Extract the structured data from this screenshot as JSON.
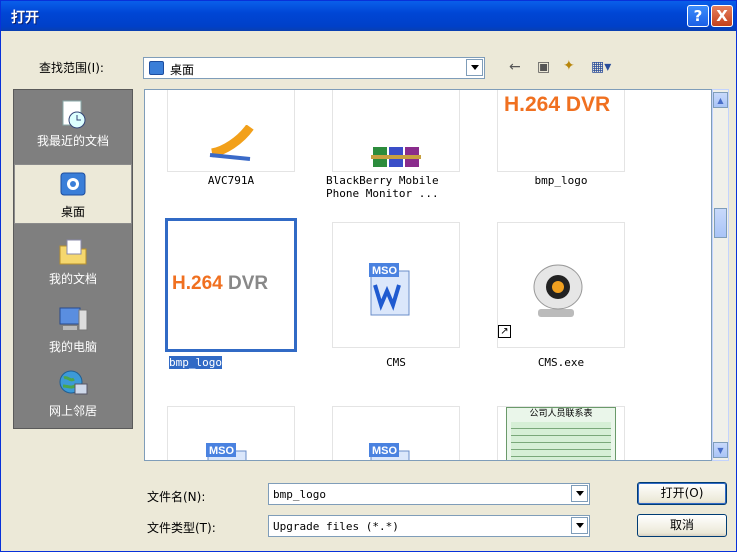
{
  "window": {
    "title": "打开",
    "help_label": "?",
    "close_label": "X"
  },
  "lookin": {
    "label": "查找范围(I):",
    "value": "桌面",
    "icon": "desktop-icon"
  },
  "toolbar": {
    "back": "←",
    "up": "▣",
    "new_folder": "✦",
    "views": "▦▾"
  },
  "places": [
    {
      "label": "我最近的文档",
      "icon": "recent-docs-icon"
    },
    {
      "label": "桌面",
      "icon": "desktop-icon",
      "selected": true
    },
    {
      "label": "我的文档",
      "icon": "my-documents-icon"
    },
    {
      "label": "我的电脑",
      "icon": "my-computer-icon"
    },
    {
      "label": "网上邻居",
      "icon": "network-icon"
    }
  ],
  "files": {
    "row1": [
      {
        "name": "AVC791A",
        "icon": "app-icon"
      },
      {
        "name": "BlackBerry Mobile\nPhone Monitor ...",
        "icon": "archive-icon"
      },
      {
        "name": "bmp_logo",
        "icon": "image-thumbnail",
        "thumb_text": "H.264 DVR"
      }
    ],
    "row2": [
      {
        "name": "bmp_logo",
        "icon": "image-thumbnail",
        "thumb_text_a": "H.264",
        "thumb_text_b": "DVR",
        "selected": true
      },
      {
        "name": "CMS",
        "icon": "word-doc-icon",
        "badge": "MSO"
      },
      {
        "name": "CMS.exe",
        "icon": "webcam-icon",
        "shortcut": true
      }
    ],
    "row3": [
      {
        "name": "",
        "icon": "word-doc-icon",
        "badge": "MSO"
      },
      {
        "name": "",
        "icon": "word-doc-icon",
        "badge": "MSO"
      },
      {
        "name": "",
        "icon": "spreadsheet-thumbnail",
        "thumb_title": "公司人员联系表"
      }
    ]
  },
  "filename": {
    "label": "文件名(N):",
    "value": "bmp_logo"
  },
  "filetype": {
    "label": "文件类型(T):",
    "value": "Upgrade files (*.*)"
  },
  "buttons": {
    "open": "打开(O)",
    "cancel": "取消"
  }
}
